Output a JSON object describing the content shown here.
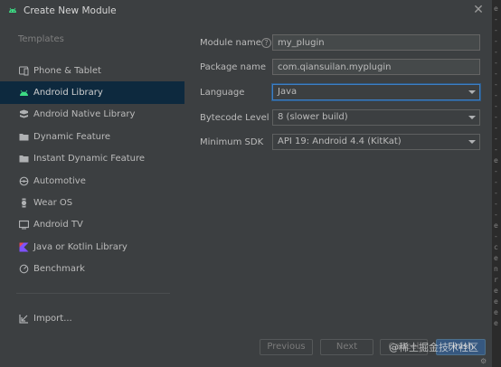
{
  "window": {
    "title": "Create New Module"
  },
  "sidebar": {
    "section_label": "Templates",
    "items": [
      {
        "label": "Phone & Tablet",
        "icon": "phone-tablet-icon"
      },
      {
        "label": "Android Library",
        "icon": "android-icon",
        "selected": true
      },
      {
        "label": "Android Native Library",
        "icon": "native-library-icon"
      },
      {
        "label": "Dynamic Feature",
        "icon": "folder-icon"
      },
      {
        "label": "Instant Dynamic Feature",
        "icon": "folder-icon"
      },
      {
        "label": "Automotive",
        "icon": "steering-wheel-icon"
      },
      {
        "label": "Wear OS",
        "icon": "watch-icon"
      },
      {
        "label": "Android TV",
        "icon": "tv-icon"
      },
      {
        "label": "Java or Kotlin Library",
        "icon": "kotlin-icon"
      },
      {
        "label": "Benchmark",
        "icon": "gauge-icon"
      }
    ],
    "import_label": "Import..."
  },
  "form": {
    "module_name": {
      "label": "Module name",
      "value": "my_plugin"
    },
    "package_name": {
      "label": "Package name",
      "value": "com.qiansuilan.myplugin"
    },
    "language": {
      "label": "Language",
      "value": "Java"
    },
    "bytecode_level": {
      "label": "Bytecode Level",
      "value": "8 (slower build)"
    },
    "minimum_sdk": {
      "label": "Minimum SDK",
      "value": "API 19: Android 4.4 (KitKat)"
    }
  },
  "footer": {
    "previous": "Previous",
    "next": "Next",
    "cancel": "Cancel",
    "finish": "Finish"
  },
  "watermark": "@稀土掘金技术社区",
  "editor_strip": [
    "e",
    "-",
    "-",
    "-",
    "-",
    "-",
    "-",
    "-",
    "-",
    "-",
    "-",
    "-",
    "-",
    "-",
    "e",
    "-",
    "-",
    "-",
    "-",
    "-",
    "e",
    "-",
    "c",
    "e",
    "n",
    "r",
    "e",
    "e",
    "e",
    "e"
  ],
  "colors": {
    "selection": "#0d293e",
    "focus": "#3d7fc4",
    "android_green": "#3ddc84",
    "kotlin": "#7f52ff"
  }
}
